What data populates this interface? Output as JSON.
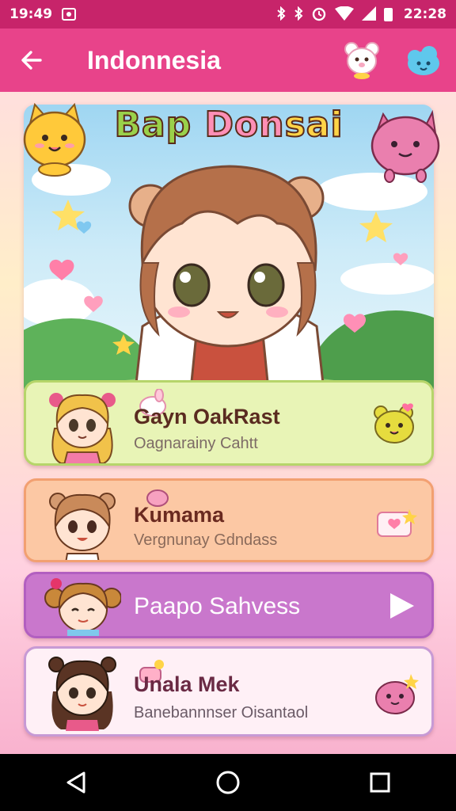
{
  "status_bar": {
    "time_left": "19:49",
    "time_right": "22:28",
    "icons": [
      "notification-icon",
      "bluetooth-icon",
      "bluetooth-icon",
      "alarm-icon",
      "wifi-icon",
      "signal-icon",
      "battery-icon"
    ]
  },
  "app_bar": {
    "title": "Indonnesia",
    "back_icon": "arrow-left-icon",
    "actions": [
      "bear-icon",
      "cloud-icon"
    ]
  },
  "hero": {
    "title_part_1": "Bap",
    "title_part_2": "Don",
    "title_part_3": "sai"
  },
  "characters": [
    {
      "name": "Gayn OakRast",
      "subtitle": "Oagnarainy Cahtt",
      "color": "#e8f4b6"
    },
    {
      "name": "Kumama",
      "subtitle": "Vergnunay Gdndass",
      "color": "#fcc8a4"
    },
    {
      "name": "Paapo Sahvess",
      "subtitle": "",
      "color": "#c977cc"
    },
    {
      "name": "Unala Mek",
      "subtitle": "Banebannnser Oisantaol",
      "color": "#fff0f6"
    }
  ],
  "nav_bar": {
    "back": "triangle-back-icon",
    "home": "circle-home-icon",
    "recents": "square-recents-icon"
  },
  "colors": {
    "status_bar": "#c7246a",
    "app_bar": "#e8438a",
    "accent_pink": "#ff8fb6"
  }
}
